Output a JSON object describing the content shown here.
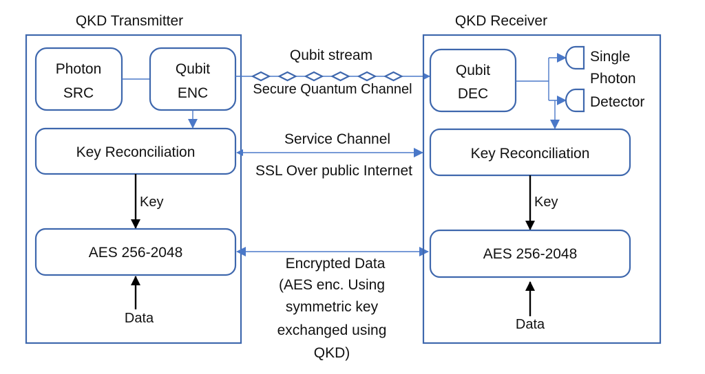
{
  "transmitter": {
    "title": "QKD Transmitter",
    "photon_src": [
      "Photon",
      "SRC"
    ],
    "qubit_enc": [
      "Qubit",
      "ENC"
    ],
    "key_reconciliation": "Key Reconciliation",
    "key_label": "Key",
    "aes": "AES 256-2048",
    "data_label": "Data"
  },
  "receiver": {
    "title": "QKD Receiver",
    "qubit_dec": [
      "Qubit",
      "DEC"
    ],
    "detector_label": [
      "Single",
      "Photon",
      "Detector"
    ],
    "key_reconciliation": "Key Reconciliation",
    "key_label": "Key",
    "aes": "AES 256-2048",
    "data_label": "Data"
  },
  "channels": {
    "quantum": {
      "top_label": "Qubit stream",
      "bottom_label": "Secure Quantum Channel",
      "qubit_count": 6
    },
    "service": {
      "top_label": "Service Channel",
      "bottom_label": "SSL Over public Internet"
    },
    "encrypted": {
      "lines": [
        "Encrypted Data",
        "(AES enc. Using",
        "symmetric key",
        "exchanged using",
        "QKD)"
      ]
    }
  },
  "colors": {
    "frame": "#3e67ad",
    "connector": "#4a78c8",
    "text": "#111111"
  }
}
